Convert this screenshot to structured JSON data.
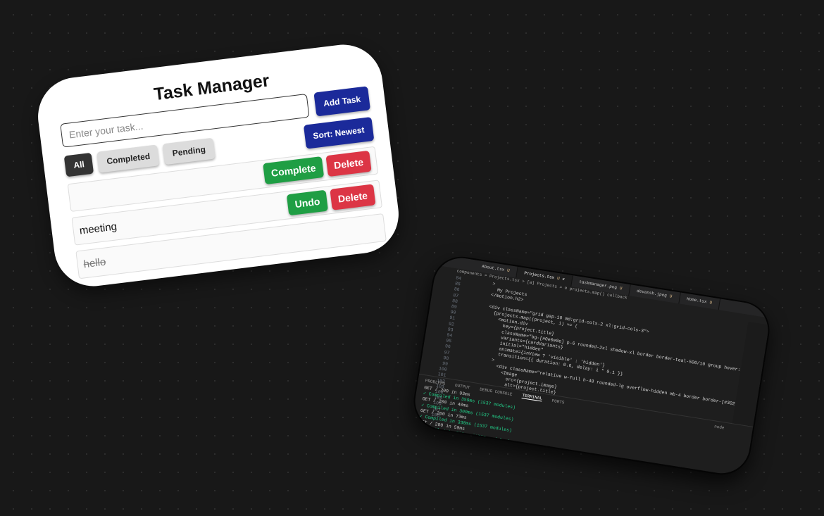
{
  "task_manager": {
    "title": "Task Manager",
    "input_placeholder": "Enter your task...",
    "add_button": "Add Task",
    "sort_button": "Sort: Newest",
    "filters": [
      "All",
      "Completed",
      "Pending"
    ],
    "active_filter": "All",
    "tasks": [
      {
        "text": "",
        "primary_action": "Complete",
        "delete": "Delete",
        "completed": false
      },
      {
        "text": "meeting",
        "primary_action": "Undo",
        "delete": "Delete",
        "completed": true
      },
      {
        "text": "hello",
        "completed": true
      }
    ]
  },
  "editor": {
    "tabs": [
      {
        "label": "About.tsx",
        "status": "U"
      },
      {
        "label": "Projects.tsx",
        "status": "U"
      },
      {
        "label": "taskmanager.png",
        "status": "U"
      },
      {
        "label": "devansh.jpeg",
        "status": "U"
      },
      {
        "label": "Home.tsx",
        "status": "U"
      }
    ],
    "breadcrumb": "components > Projects.tsx > [ø] Projects > ⊘ projects.map() callback",
    "line_numbers": [
      "84",
      "85",
      "86",
      "87",
      "88",
      "89",
      "90",
      "91",
      "92",
      "93",
      "94",
      "95",
      "96",
      "97",
      "98",
      "99",
      "100",
      "101",
      "102",
      "103",
      "104",
      "105",
      "106",
      "107",
      "108"
    ],
    "code_lines": [
      "          >",
      "            My Projects",
      "          </motion.h2>",
      "",
      "          <div className=\"grid gap-10 md:grid-cols-2 xl:grid-cols-3\">",
      "            {projects.map((project, i) => (",
      "              <motion.div",
      "                key={project.title}",
      "                className=\"bg-[#0e0e0e] p-6 rounded-2xl shadow-xl border border-teal-500/10 group hover:shadow-teal-500/20 hover:scale-[1.01]",
      "                variants={cardVariants}",
      "                initial=\"hidden\"",
      "                animate={inView ? 'visible' : 'hidden'}",
      "                transition={{ duration: 0.6, delay: i * 0.1 }}",
      "              >",
      "                <div className=\"relative w-full h-48 rounded-lg overflow-hidden mb-4 border border-[#30292f]\">",
      "                  <Image",
      "                    src={project.image}",
      "                    alt={project.title}",
      "                    fill",
      "                    className=\"object-contain p-6 bg-[#292929]\"",
      "                  />",
      "                </div>",
      "",
      "                <h3 className=\"text-teal-400 text-xl font-semibold font-serif mb-2\">"
    ],
    "panel_tabs": [
      "PROBLEMS",
      "OUTPUT",
      "DEBUG CONSOLE",
      "TERMINAL",
      "PORTS"
    ],
    "active_panel": "TERMINAL",
    "terminal_lines": [
      "GET / 200 in 93ms",
      "✓ Compiled in 359ms (1537 modules)",
      "GET / 200 in 40ms",
      "✓ Compiled in 300ms (1537 modules)",
      "GET / 200 in 73ms",
      "✓ Compiled in 330ms (1537 modules)",
      "GET / 200 in 59ms",
      "✓ Compiled in 568ms (1537 modules)",
      "GET / 200 in 80ms"
    ],
    "terminal_shell": "node"
  }
}
